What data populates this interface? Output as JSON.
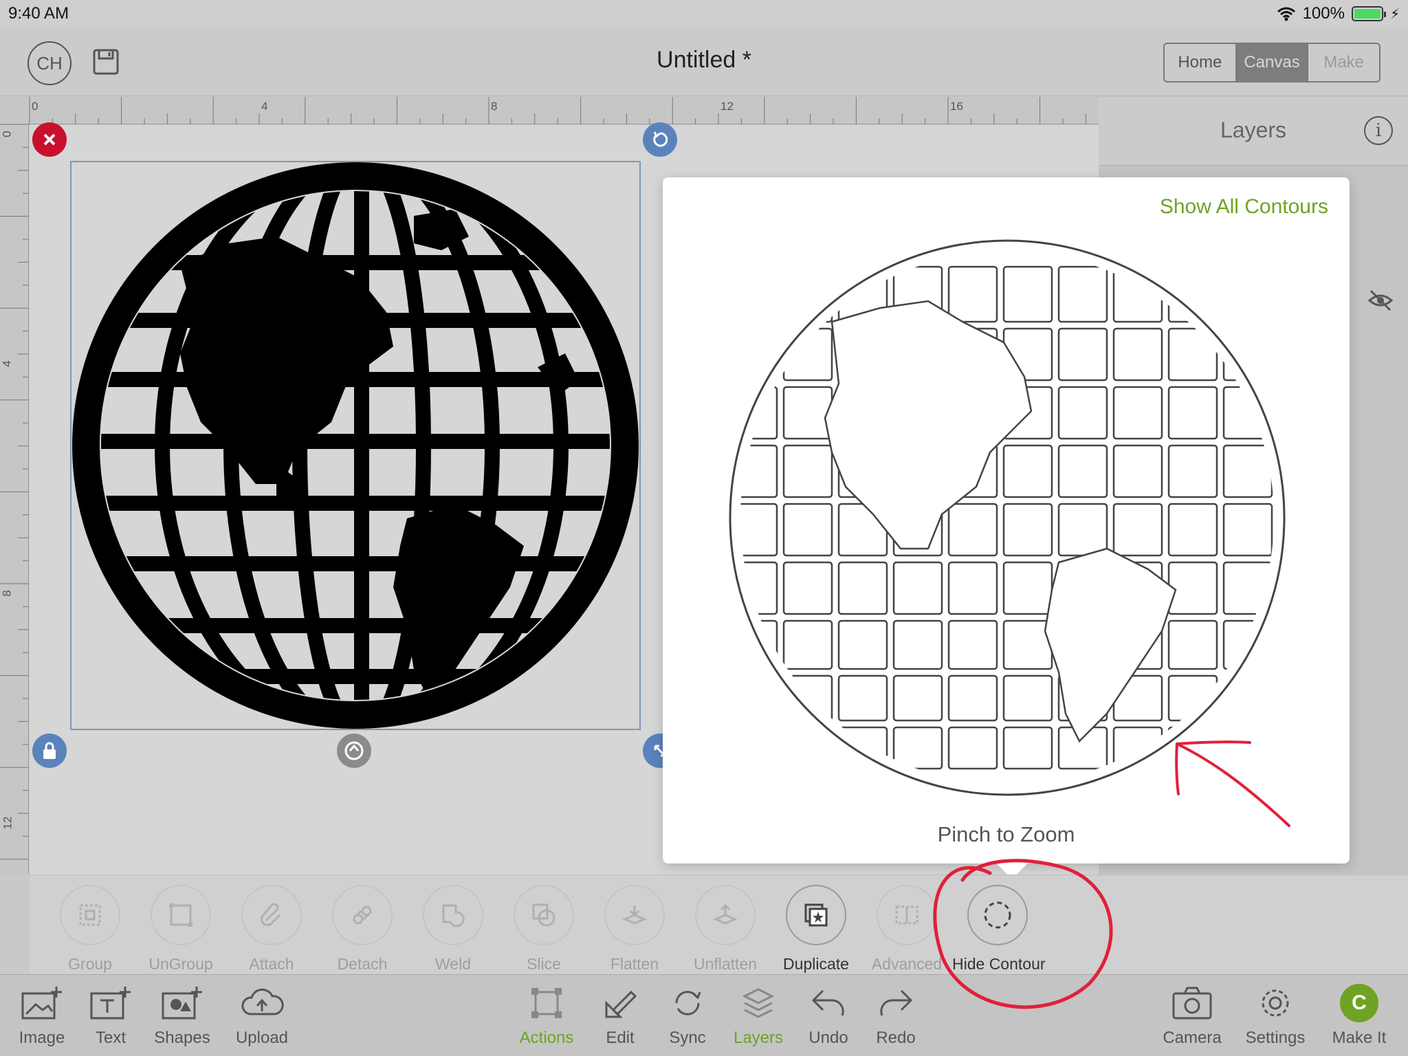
{
  "status": {
    "time": "9:40 AM",
    "battery": "100%"
  },
  "header": {
    "avatar_initials": "CH",
    "title": "Untitled *",
    "segments": [
      {
        "label": "Home"
      },
      {
        "label": "Canvas"
      },
      {
        "label": "Make"
      }
    ]
  },
  "ruler": {
    "top": [
      "0",
      "4",
      "8",
      "12",
      "16"
    ],
    "left": [
      "0",
      "4",
      "8",
      "12"
    ]
  },
  "layers_panel": {
    "title": "Layers"
  },
  "popover": {
    "show_all": "Show All Contours",
    "hint": "Pinch to Zoom"
  },
  "actions": [
    {
      "label": "Group",
      "icon": "group-icon"
    },
    {
      "label": "UnGroup",
      "icon": "ungroup-icon"
    },
    {
      "label": "Attach",
      "icon": "paperclip-icon"
    },
    {
      "label": "Detach",
      "icon": "detach-icon"
    },
    {
      "label": "Weld",
      "icon": "weld-icon"
    },
    {
      "label": "Slice",
      "icon": "slice-icon"
    },
    {
      "label": "Flatten",
      "icon": "flatten-icon"
    },
    {
      "label": "Unflatten",
      "icon": "unflatten-icon"
    },
    {
      "label": "Duplicate",
      "icon": "duplicate-icon"
    },
    {
      "label": "Advanced",
      "icon": "advanced-icon"
    },
    {
      "label": "Hide Contour",
      "icon": "contour-icon"
    }
  ],
  "toolbar_left": [
    {
      "label": "Image"
    },
    {
      "label": "Text"
    },
    {
      "label": "Shapes"
    },
    {
      "label": "Upload"
    }
  ],
  "toolbar_center": [
    {
      "label": "Actions"
    },
    {
      "label": "Edit"
    },
    {
      "label": "Sync"
    },
    {
      "label": "Layers"
    },
    {
      "label": "Undo"
    },
    {
      "label": "Redo"
    }
  ],
  "toolbar_right": [
    {
      "label": "Camera"
    },
    {
      "label": "Settings"
    },
    {
      "label": "Make It"
    }
  ],
  "colors": {
    "accent_green": "#6ea324",
    "handle_blue": "#5a83bc",
    "close_red": "#c8102e",
    "annotation_red": "#e0203a"
  }
}
